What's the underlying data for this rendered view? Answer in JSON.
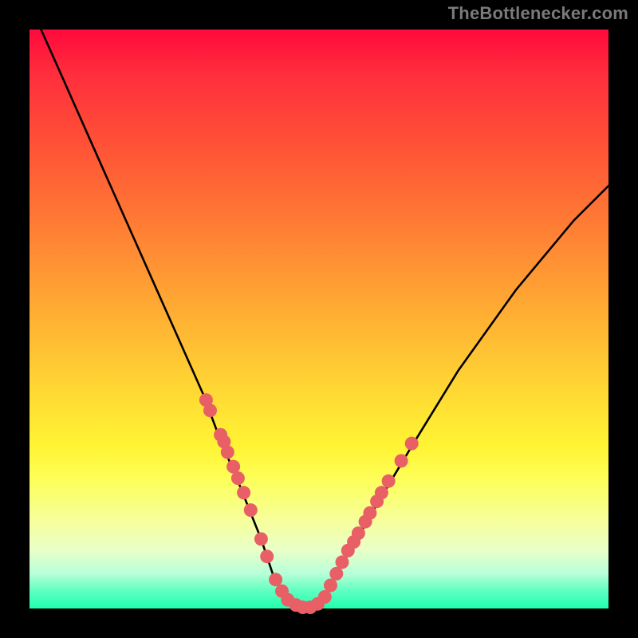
{
  "attribution": "TheBottlenecker.com",
  "chart_data": {
    "type": "line",
    "title": "",
    "xlabel": "",
    "ylabel": "",
    "xlim": [
      0,
      100
    ],
    "ylim": [
      0,
      100
    ],
    "series": [
      {
        "name": "curve",
        "x": [
          2,
          6,
          10,
          14,
          18,
          22,
          26,
          30,
          33,
          36,
          38,
          40,
          41,
          42,
          43,
          44,
          45,
          47,
          49,
          51,
          53,
          56,
          60,
          66,
          74,
          84,
          94,
          100
        ],
        "y": [
          100,
          91,
          82,
          73,
          64,
          55,
          46,
          37,
          29,
          22,
          17,
          12,
          9,
          6,
          4,
          2,
          1,
          0,
          0,
          2,
          6,
          11,
          18,
          28,
          41,
          55,
          67,
          73
        ]
      }
    ],
    "scatter": [
      {
        "name": "dots",
        "color": "#e85f66",
        "points": [
          [
            30.5,
            36.0
          ],
          [
            31.2,
            34.2
          ],
          [
            33.0,
            30.0
          ],
          [
            33.6,
            28.8
          ],
          [
            34.2,
            27.0
          ],
          [
            35.2,
            24.5
          ],
          [
            36.0,
            22.5
          ],
          [
            37.0,
            20.0
          ],
          [
            38.2,
            17.0
          ],
          [
            40.0,
            12.0
          ],
          [
            41.0,
            9.0
          ],
          [
            42.5,
            5.0
          ],
          [
            43.6,
            3.0
          ],
          [
            44.6,
            1.5
          ],
          [
            46.0,
            0.6
          ],
          [
            47.2,
            0.2
          ],
          [
            48.5,
            0.2
          ],
          [
            49.8,
            0.8
          ],
          [
            51.0,
            2.0
          ],
          [
            52.0,
            4.0
          ],
          [
            53.0,
            6.0
          ],
          [
            54.0,
            8.0
          ],
          [
            55.0,
            10.0
          ],
          [
            56.0,
            11.5
          ],
          [
            56.8,
            13.0
          ],
          [
            58.0,
            15.0
          ],
          [
            58.8,
            16.5
          ],
          [
            60.0,
            18.5
          ],
          [
            60.8,
            20.0
          ],
          [
            62.0,
            22.0
          ],
          [
            64.2,
            25.5
          ],
          [
            66.0,
            28.5
          ]
        ]
      }
    ]
  }
}
